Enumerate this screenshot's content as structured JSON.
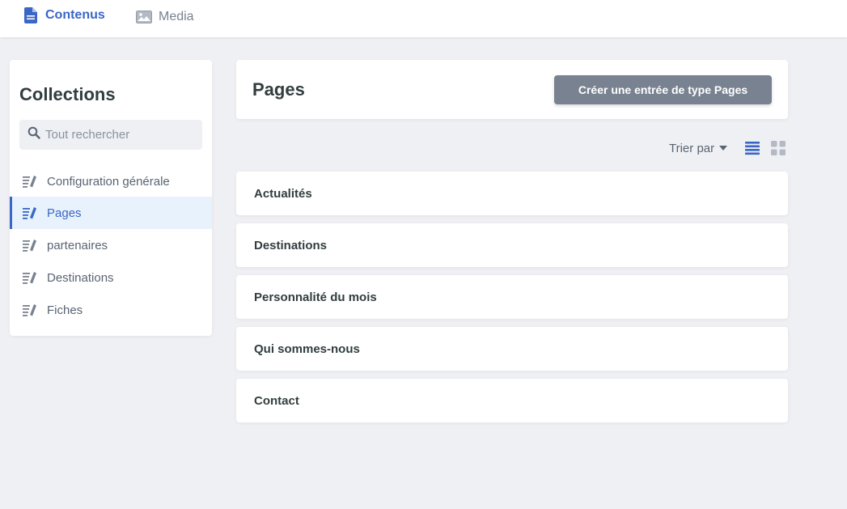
{
  "topbar": {
    "tabs": [
      {
        "label": "Contenus",
        "icon": "document-icon",
        "active": true
      },
      {
        "label": "Media",
        "icon": "image-icon",
        "active": false
      }
    ]
  },
  "sidebar": {
    "title": "Collections",
    "search": {
      "placeholder": "Tout rechercher",
      "value": ""
    },
    "items": [
      {
        "label": "Configuration générale",
        "icon": "edit-list-icon",
        "active": false
      },
      {
        "label": "Pages",
        "icon": "edit-list-icon",
        "active": true
      },
      {
        "label": "partenaires",
        "icon": "edit-list-icon",
        "active": false
      },
      {
        "label": "Destinations",
        "icon": "edit-list-icon",
        "active": false
      },
      {
        "label": "Fiches",
        "icon": "edit-list-icon",
        "active": false
      }
    ]
  },
  "main": {
    "title": "Pages",
    "create_button": "Créer une entrée de type Pages",
    "sort_label": "Trier par",
    "view_modes": {
      "list": "list-view-icon",
      "grid": "grid-view-icon",
      "selected": "list"
    },
    "entries": [
      "Actualités",
      "Destinations",
      "Personnalité du mois",
      "Qui sommes-nous",
      "Contact"
    ]
  },
  "colors": {
    "accent": "#3a66c6",
    "background": "#eff0f4",
    "button": "#798291",
    "active_bg": "#e8f2fd",
    "muted": "#798291"
  }
}
